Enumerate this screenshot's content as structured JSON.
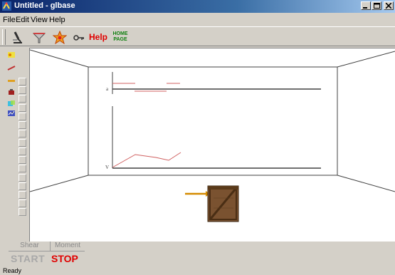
{
  "window": {
    "title": "Untitled - glbase"
  },
  "menu": {
    "file": "File",
    "edit": "Edit",
    "view": "View",
    "help": "Help"
  },
  "toolbar": {
    "help_label": "Help",
    "home_line1": "HOME",
    "home_line2": "PAGE",
    "tools": [
      "microscope-icon",
      "funnel-icon",
      "star-icon",
      "key-icon"
    ]
  },
  "plot_upper": {
    "axis_label": "a"
  },
  "plot_lower": {
    "axis_label": "V"
  },
  "bottom": {
    "tab_shear": "Shear",
    "tab_moment": "Moment",
    "start_label": "START",
    "stop_label": "STOP"
  },
  "status": {
    "text": "Ready"
  },
  "colors": {
    "plot_line": "#d06060",
    "stop": "#e00000",
    "title_bar": "#0a246a",
    "home_text": "#108010"
  }
}
